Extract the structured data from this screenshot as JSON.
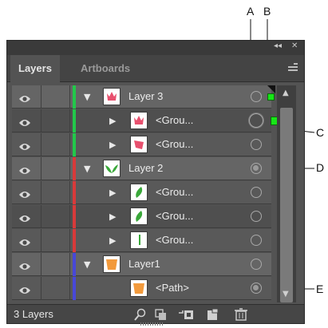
{
  "callouts": {
    "a": "A",
    "b": "B",
    "c": "C",
    "d": "D",
    "e": "E"
  },
  "window": {
    "collapse_glyph": "◂◂",
    "close_glyph": "✕"
  },
  "tabs": [
    {
      "label": "Layers"
    },
    {
      "label": "Artboards"
    }
  ],
  "layers": [
    {
      "label": "Layer 3",
      "expanded": true,
      "level": 0,
      "color": "#22c84a",
      "icon": "tulip-pink-icon"
    },
    {
      "label": "<Grou...",
      "expanded": false,
      "level": 1,
      "color": "#22c84a",
      "icon": "tulip-pink-icon"
    },
    {
      "label": "<Grou...",
      "expanded": false,
      "level": 1,
      "color": "#22c84a",
      "icon": "petal-pink-icon"
    },
    {
      "label": "Layer 2",
      "expanded": true,
      "level": 0,
      "color": "#d83a3a",
      "icon": "leaves-green-icon"
    },
    {
      "label": "<Grou...",
      "expanded": false,
      "level": 1,
      "color": "#d83a3a",
      "icon": "leaf-green-icon"
    },
    {
      "label": "<Grou...",
      "expanded": false,
      "level": 1,
      "color": "#d83a3a",
      "icon": "leaf-green-icon"
    },
    {
      "label": "<Grou...",
      "expanded": false,
      "level": 1,
      "color": "#d83a3a",
      "icon": "stem-green-icon"
    },
    {
      "label": "Layer1",
      "expanded": true,
      "level": 0,
      "color": "#4848d8",
      "icon": "pot-orange-icon"
    },
    {
      "label": "<Path>",
      "expanded": null,
      "level": 2,
      "color": "#4848d8",
      "icon": "pot-orange-icon"
    }
  ],
  "footer": {
    "count": "3 Layers"
  },
  "colors": {
    "panel": "#535353",
    "selection_square": "#17e617",
    "pink": "#e8506e",
    "green": "#3aa83a",
    "orange": "#f29a3c"
  }
}
